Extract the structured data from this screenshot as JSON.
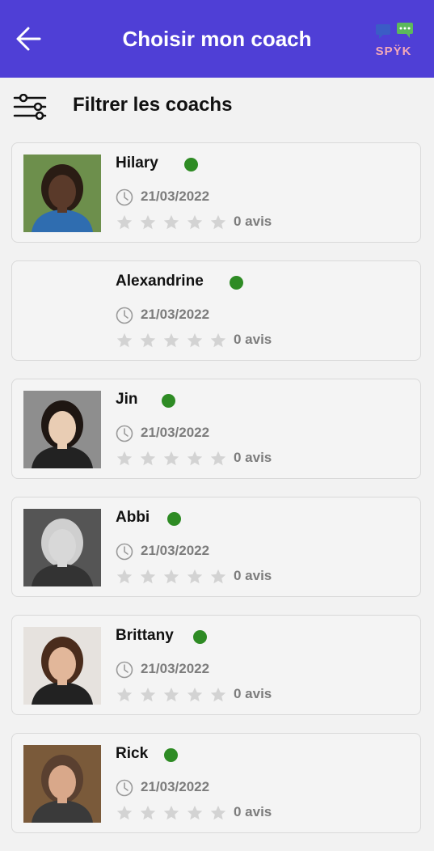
{
  "header": {
    "title": "Choisir mon coach",
    "logo_text": "SPŸK",
    "background": "#4f3fd6"
  },
  "filter": {
    "label": "Filtrer les coachs"
  },
  "coaches": [
    {
      "name": "Hilary",
      "date": "21/03/2022",
      "rating": 0,
      "reviews": "0 avis",
      "online": true,
      "has_photo": true
    },
    {
      "name": "Alexandrine",
      "date": "21/03/2022",
      "rating": 0,
      "reviews": "0 avis",
      "online": true,
      "has_photo": false
    },
    {
      "name": "Jin",
      "date": "21/03/2022",
      "rating": 0,
      "reviews": "0 avis",
      "online": true,
      "has_photo": true
    },
    {
      "name": "Abbi",
      "date": "21/03/2022",
      "rating": 0,
      "reviews": "0 avis",
      "online": true,
      "has_photo": true
    },
    {
      "name": "Brittany",
      "date": "21/03/2022",
      "rating": 0,
      "reviews": "0 avis",
      "online": true,
      "has_photo": true
    },
    {
      "name": "Rick",
      "date": "21/03/2022",
      "rating": 0,
      "reviews": "0 avis",
      "online": true,
      "has_photo": true
    }
  ],
  "colors": {
    "online": "#2e8b24",
    "star_empty": "#d3d3d3",
    "muted_text": "#7c7c7c"
  },
  "icons": {
    "back": "arrow-left-icon",
    "filter": "sliders-icon",
    "clock": "clock-icon",
    "star": "star-icon",
    "status": "online-dot"
  }
}
